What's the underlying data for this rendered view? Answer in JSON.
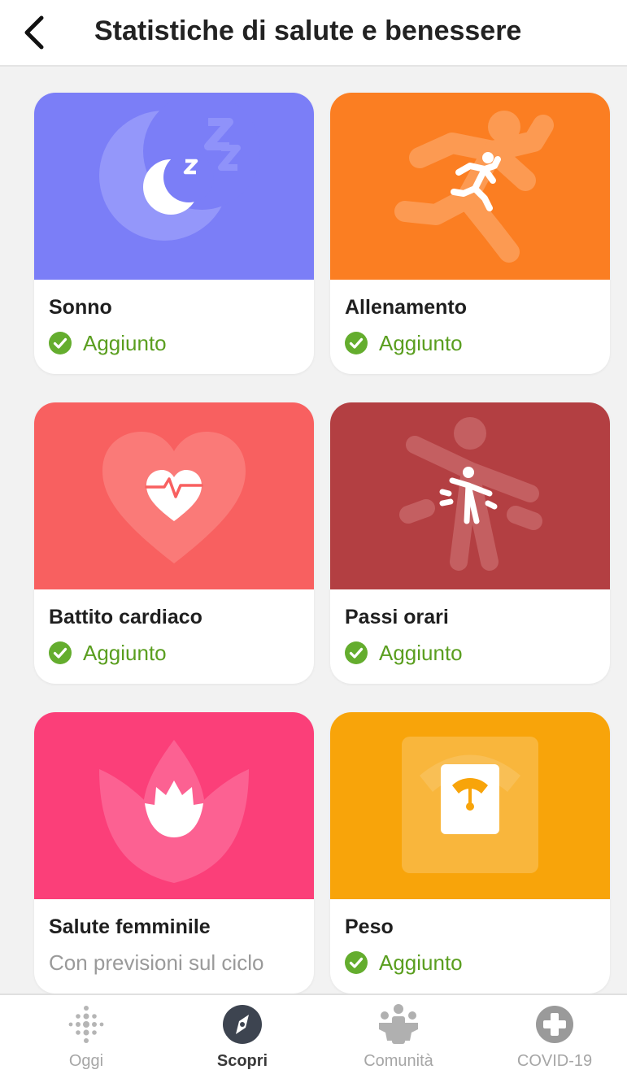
{
  "header": {
    "title": "Statistiche di salute e benessere"
  },
  "cards": [
    {
      "name": "Sonno",
      "status": "Aggiunto",
      "color": "#7b7ef7",
      "icon": "moon-icon"
    },
    {
      "name": "Allenamento",
      "status": "Aggiunto",
      "color": "#fb7e22",
      "icon": "running-person-icon"
    },
    {
      "name": "Battito cardiaco",
      "status": "Aggiunto",
      "color": "#f86060",
      "icon": "heart-rate-icon"
    },
    {
      "name": "Passi orari",
      "status": "Aggiunto",
      "color": "#b33f42",
      "icon": "person-moving-icon"
    },
    {
      "name": "Salute femminile",
      "subtitle": "Con previsioni sul ciclo",
      "color": "#fb3f79",
      "icon": "lotus-icon"
    },
    {
      "name": "Peso",
      "status": "Aggiunto",
      "color": "#f8a40a",
      "icon": "scale-icon"
    }
  ],
  "tabs": [
    {
      "label": "Oggi",
      "icon": "fitbit-dots-icon",
      "active": false
    },
    {
      "label": "Scopri",
      "icon": "compass-icon",
      "active": true
    },
    {
      "label": "Comunità",
      "icon": "community-icon",
      "active": false
    },
    {
      "label": "COVID-19",
      "icon": "plus-cross-icon",
      "active": false
    }
  ],
  "colors": {
    "status_green": "#5a9e1f",
    "check_green": "#64ad2e"
  }
}
